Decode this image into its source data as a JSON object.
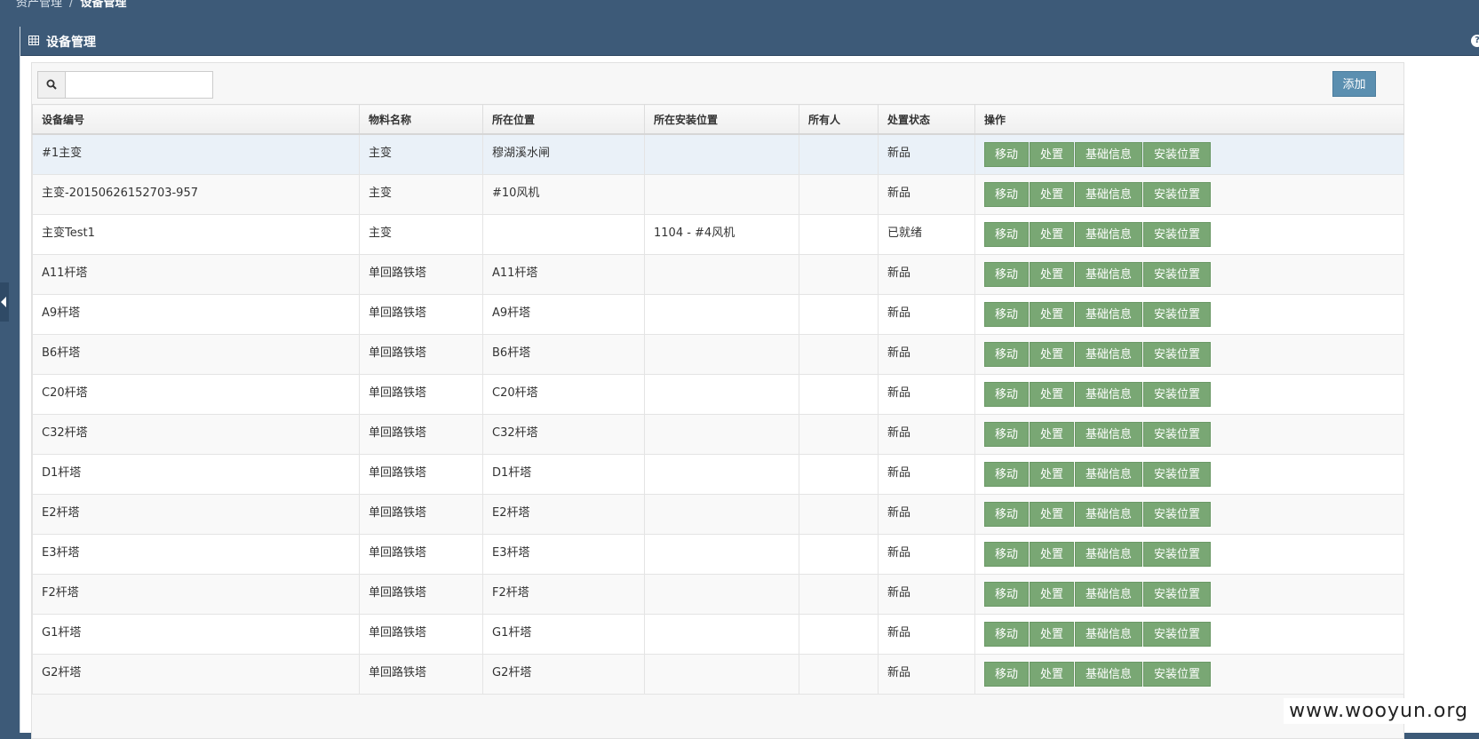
{
  "breadcrumb": {
    "parent": "资产管理",
    "separator": "/",
    "current": "设备管理"
  },
  "panel": {
    "icon": "table-grid-icon",
    "title": "设备管理",
    "help_icon": "question-icon",
    "help_label": "?"
  },
  "toolbar": {
    "search_icon": "search-icon",
    "search_value": "",
    "search_placeholder": "",
    "add_label": "添加"
  },
  "table": {
    "headers": [
      "设备编号",
      "物料名称",
      "所在位置",
      "所在安装位置",
      "所有人",
      "处置状态",
      "操作"
    ],
    "actions": [
      "移动",
      "处置",
      "基础信息",
      "安装位置"
    ],
    "rows": [
      {
        "code": "#1主变",
        "material": "主变",
        "location": "穆湖溪水闸",
        "install": "",
        "owner": "",
        "status": "新品"
      },
      {
        "code": "主变-20150626152703-957",
        "material": "主变",
        "location": "#10风机",
        "install": "",
        "owner": "",
        "status": "新品"
      },
      {
        "code": "主变Test1",
        "material": "主变",
        "location": "",
        "install": "1104 - #4风机",
        "owner": "",
        "status": "已就绪"
      },
      {
        "code": "A11杆塔",
        "material": "单回路铁塔",
        "location": "A11杆塔",
        "install": "",
        "owner": "",
        "status": "新品"
      },
      {
        "code": "A9杆塔",
        "material": "单回路铁塔",
        "location": "A9杆塔",
        "install": "",
        "owner": "",
        "status": "新品"
      },
      {
        "code": "B6杆塔",
        "material": "单回路铁塔",
        "location": "B6杆塔",
        "install": "",
        "owner": "",
        "status": "新品"
      },
      {
        "code": "C20杆塔",
        "material": "单回路铁塔",
        "location": "C20杆塔",
        "install": "",
        "owner": "",
        "status": "新品"
      },
      {
        "code": "C32杆塔",
        "material": "单回路铁塔",
        "location": "C32杆塔",
        "install": "",
        "owner": "",
        "status": "新品"
      },
      {
        "code": "D1杆塔",
        "material": "单回路铁塔",
        "location": "D1杆塔",
        "install": "",
        "owner": "",
        "status": "新品"
      },
      {
        "code": "E2杆塔",
        "material": "单回路铁塔",
        "location": "E2杆塔",
        "install": "",
        "owner": "",
        "status": "新品"
      },
      {
        "code": "E3杆塔",
        "material": "单回路铁塔",
        "location": "E3杆塔",
        "install": "",
        "owner": "",
        "status": "新品"
      },
      {
        "code": "F2杆塔",
        "material": "单回路铁塔",
        "location": "F2杆塔",
        "install": "",
        "owner": "",
        "status": "新品"
      },
      {
        "code": "G1杆塔",
        "material": "单回路铁塔",
        "location": "G1杆塔",
        "install": "",
        "owner": "",
        "status": "新品"
      },
      {
        "code": "G2杆塔",
        "material": "单回路铁塔",
        "location": "G2杆塔",
        "install": "",
        "owner": "",
        "status": "新品"
      }
    ]
  },
  "watermark": "www.wooyun.org",
  "colors": {
    "header_bar": "#3d5a78",
    "add_button": "#5b8fb0",
    "action_button": "#79a774",
    "selected_row": "#eaf1f8"
  }
}
